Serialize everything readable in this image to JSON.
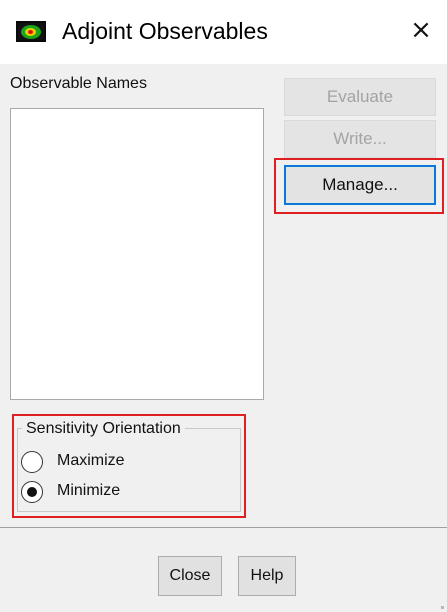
{
  "window": {
    "title": "Adjoint Observables",
    "icon": "fluent-app-icon",
    "close_glyph": "×"
  },
  "observables": {
    "label": "Observable Names",
    "items": []
  },
  "buttons": {
    "evaluate": "Evaluate",
    "write": "Write...",
    "manage": "Manage...",
    "close": "Close",
    "help": "Help"
  },
  "sensitivity": {
    "title": "Sensitivity Orientation",
    "options": [
      {
        "label": "Maximize",
        "selected": false
      },
      {
        "label": "Minimize",
        "selected": true
      }
    ]
  },
  "colors": {
    "highlight": "#e02020",
    "focus_border": "#0a78d7",
    "disabled_text": "#a3a3a3"
  }
}
